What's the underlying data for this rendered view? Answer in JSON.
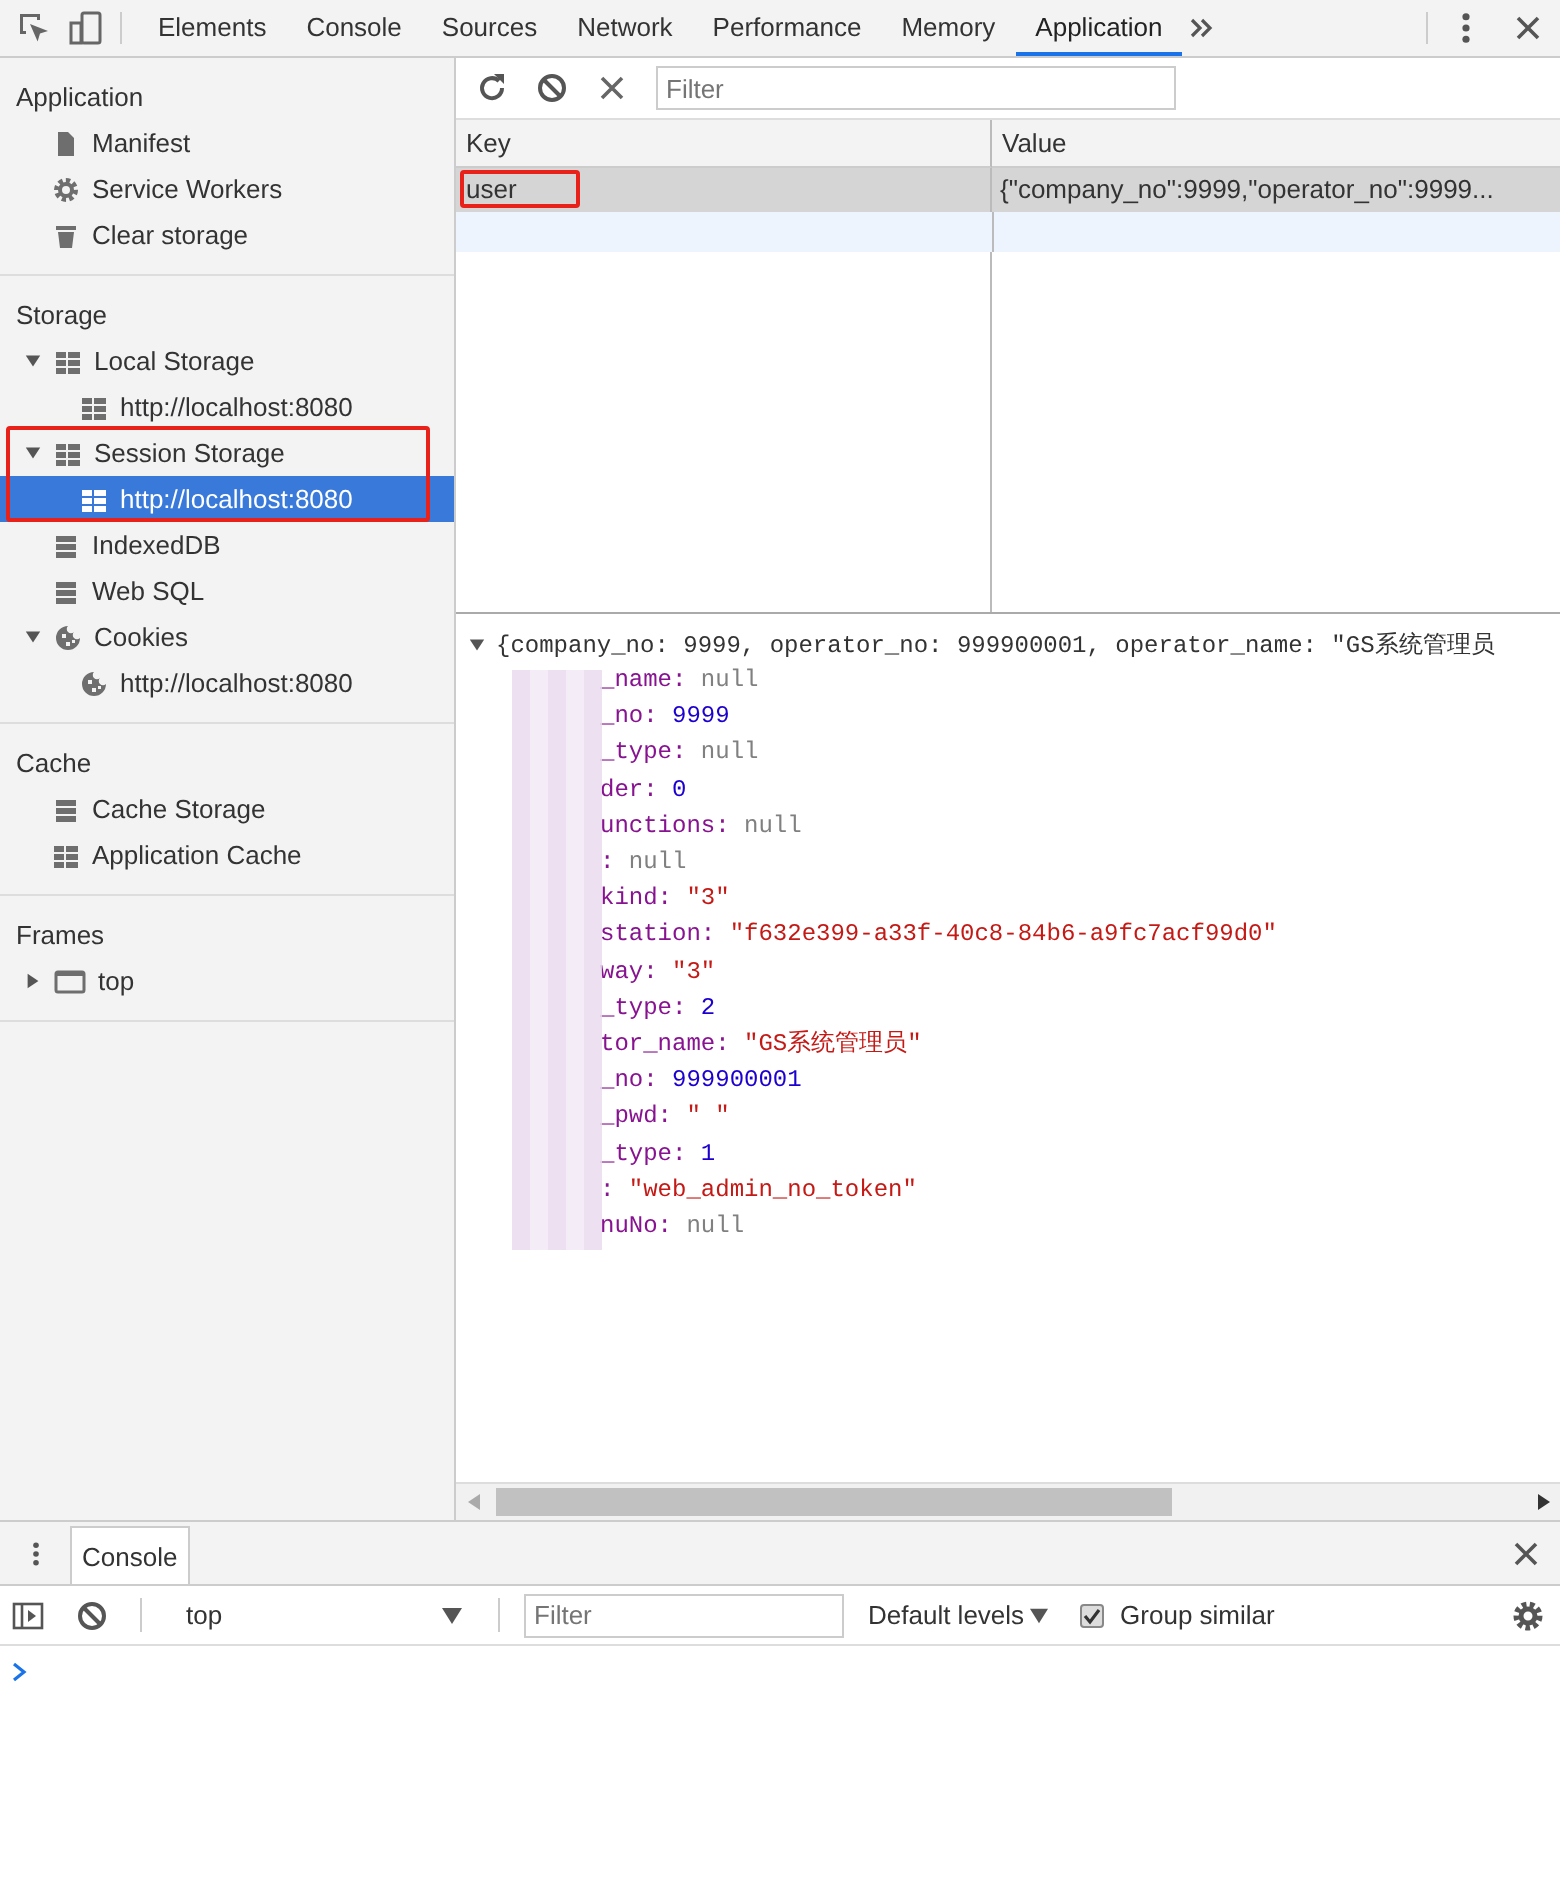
{
  "toolbar": {
    "tabs": [
      {
        "label": "Elements",
        "selected": false
      },
      {
        "label": "Console",
        "selected": false
      },
      {
        "label": "Sources",
        "selected": false
      },
      {
        "label": "Network",
        "selected": false
      },
      {
        "label": "Performance",
        "selected": false
      },
      {
        "label": "Memory",
        "selected": false
      },
      {
        "label": "Application",
        "selected": true
      }
    ]
  },
  "sidebar": {
    "sections": [
      {
        "title": "Application",
        "items": [
          {
            "label": "Manifest",
            "kind": "file",
            "selected": false
          },
          {
            "label": "Service Workers",
            "kind": "gear",
            "selected": false
          },
          {
            "label": "Clear storage",
            "kind": "trash",
            "selected": false
          }
        ]
      },
      {
        "title": "Storage",
        "items": [
          {
            "label": "Local Storage",
            "kind": "grid",
            "selected": false,
            "expanded": true,
            "children": [
              {
                "label": "http://localhost:8080",
                "kind": "grid",
                "selected": false
              }
            ]
          },
          {
            "label": "Session Storage",
            "kind": "grid",
            "selected": false,
            "expanded": true,
            "outlined": true,
            "children": [
              {
                "label": "http://localhost:8080",
                "kind": "grid",
                "selected": true
              }
            ]
          },
          {
            "label": "IndexedDB",
            "kind": "db",
            "selected": false
          },
          {
            "label": "Web SQL",
            "kind": "db",
            "selected": false
          },
          {
            "label": "Cookies",
            "kind": "cookie",
            "selected": false,
            "expanded": true,
            "children": [
              {
                "label": "http://localhost:8080",
                "kind": "cookie",
                "selected": false
              }
            ]
          }
        ]
      },
      {
        "title": "Cache",
        "items": [
          {
            "label": "Cache Storage",
            "kind": "db",
            "selected": false
          },
          {
            "label": "Application Cache",
            "kind": "grid",
            "selected": false
          }
        ]
      },
      {
        "title": "Frames",
        "items": [
          {
            "label": "top",
            "kind": "frame",
            "selected": false,
            "expanded": false
          }
        ]
      }
    ]
  },
  "storage": {
    "filter": {
      "placeholder": "Filter"
    },
    "columns": [
      "Key",
      "Value"
    ],
    "rows": [
      {
        "key": "user",
        "value": "{\"company_no\":9999,\"operator_no\":9999...",
        "selected": true,
        "outlined": true
      }
    ]
  },
  "preview": {
    "expanded": true,
    "summary": "{company_no: 9999, operator_no: 999900001, operator_name: \"GS系统管理员",
    "properties": [
      {
        "key": "_name:",
        "value": "null",
        "kind": "null"
      },
      {
        "key": "_no:",
        "value": "9999",
        "kind": "number"
      },
      {
        "key": "_type:",
        "value": "null",
        "kind": "null"
      },
      {
        "key": "der:",
        "value": "0",
        "kind": "number"
      },
      {
        "key": "unctions:",
        "value": "null",
        "kind": "null"
      },
      {
        "key": ":",
        "value": "null",
        "kind": "null"
      },
      {
        "key": "kind:",
        "value": "\"3\"",
        "kind": "string"
      },
      {
        "key": "station:",
        "value": "\"f632e399-a33f-40c8-84b6-a9fc7acf99d0\"",
        "kind": "string"
      },
      {
        "key": "way:",
        "value": "\"3\"",
        "kind": "string"
      },
      {
        "key": "_type:",
        "value": "2",
        "kind": "number"
      },
      {
        "key": "tor_name:",
        "value": "\"GS系统管理员\"",
        "kind": "string"
      },
      {
        "key": "_no:",
        "value": "999900001",
        "kind": "number"
      },
      {
        "key": "_pwd:",
        "value": "\" \"",
        "kind": "string"
      },
      {
        "key": "_type:",
        "value": "1",
        "kind": "number"
      },
      {
        "key": ":",
        "value": "\"web_admin_no_token\"",
        "kind": "string"
      },
      {
        "key": "nuNo:",
        "value": "null",
        "kind": "null"
      }
    ]
  },
  "drawer": {
    "tabs": [
      {
        "label": "Console",
        "selected": true
      }
    ],
    "context": "top",
    "filter": {
      "placeholder": "Filter"
    },
    "levels": "Default levels",
    "group_similar": {
      "label": "Group similar",
      "checked": true
    }
  }
}
